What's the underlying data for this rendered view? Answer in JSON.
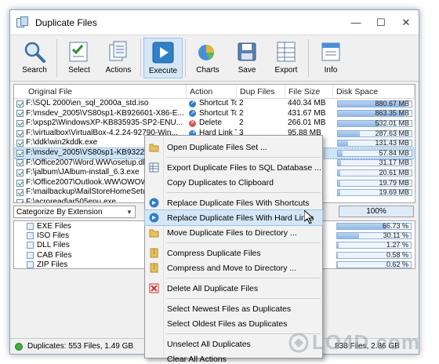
{
  "window": {
    "title": "Duplicate Files",
    "controls": [
      "—",
      "☐",
      "✕"
    ]
  },
  "toolbar": {
    "buttons": [
      {
        "label": "Search",
        "icon": "search-icon"
      },
      {
        "label": "Select",
        "icon": "select-icon"
      },
      {
        "label": "Actions",
        "icon": "actions-icon"
      },
      {
        "label": "Execute",
        "icon": "execute-icon"
      },
      {
        "label": "Charts",
        "icon": "charts-icon"
      },
      {
        "label": "Save",
        "icon": "save-icon"
      },
      {
        "label": "Export",
        "icon": "export-icon"
      },
      {
        "label": "Info",
        "icon": "info-icon"
      }
    ]
  },
  "grid": {
    "columns": [
      "Original File",
      "Action",
      "Dup Files",
      "File Size",
      "Disk Space"
    ],
    "rows": [
      {
        "file": "F:\\SQL 2000\\en_sql_2000a_std.iso",
        "action": "Shortcut To: ...",
        "dup": "2",
        "size": "440.34 MB",
        "disk": "880.67 MB",
        "pct": 92,
        "icon": "shortcut"
      },
      {
        "file": "F:\\msdev_2005\\VS80sp1-KB926601-X86-E...",
        "action": "Shortcut To: ...",
        "dup": "2",
        "size": "431.67 MB",
        "disk": "863.35 MB",
        "pct": 90,
        "icon": "shortcut"
      },
      {
        "file": "F:\\xpsp2\\WindowsXP-KB835935-SP2-ENU...",
        "action": "Delete",
        "dup": "2",
        "size": "266.01 MB",
        "disk": "532.01 MB",
        "pct": 56,
        "icon": "delete"
      },
      {
        "file": "F:\\virtualbox\\VirtualBox-4.2.24-92790-Win...",
        "action": "Hard Link To: ...",
        "dup": "3",
        "size": "95.88 MB",
        "disk": "287.63 MB",
        "pct": 30,
        "icon": "hardlink"
      },
      {
        "file": "F:\\ddk\\win2kddk.exe",
        "action": "Compress",
        "dup": "2",
        "size": "65.71 MB",
        "disk": "131.43 MB",
        "pct": 14,
        "icon": "compress"
      },
      {
        "file": "F:\\msdev_2005\\VS80sp1-KB932232-X",
        "action": "",
        "dup": "",
        "size": "",
        "disk": "57.84 MB",
        "pct": 6,
        "icon": ""
      },
      {
        "file": "F:\\Office2007\\Word.WW\\osetup.dll",
        "action": "",
        "dup": "",
        "size": "",
        "disk": "31.17 MB",
        "pct": 4,
        "icon": ""
      },
      {
        "file": "F:\\jalbum\\JAlbum-install_6.3.exe",
        "action": "",
        "dup": "",
        "size": "",
        "disk": "20.61 MB",
        "pct": 3,
        "icon": ""
      },
      {
        "file": "F:\\Office2007\\Outlook.WW\\OWOWE",
        "action": "",
        "dup": "",
        "size": "",
        "disk": "19.79 MB",
        "pct": 3,
        "icon": ""
      },
      {
        "file": "F:\\mailbackup\\MailStoreHomeSetup",
        "action": "",
        "dup": "",
        "size": "",
        "disk": "19.69 MB",
        "pct": 3,
        "icon": ""
      },
      {
        "file": "F:\\acroread\\ar505enu.exe",
        "action": "",
        "dup": "",
        "size": "",
        "disk": "",
        "pct": 0,
        "icon": ""
      }
    ]
  },
  "categorize": {
    "selected": "Categorize By Extension",
    "percent": "100%"
  },
  "categories": [
    {
      "label": "EXE Files",
      "value": "66.73 %",
      "pct": 67
    },
    {
      "label": "ISO Files",
      "value": "30.11 %",
      "pct": 30
    },
    {
      "label": "DLL Files",
      "value": "1.27 %",
      "pct": 2
    },
    {
      "label": "CAB Files",
      "value": "0.58 %",
      "pct": 1
    },
    {
      "label": "ZIP Files",
      "value": "0.62 %",
      "pct": 1
    }
  ],
  "status": {
    "left": "Duplicates: 553 Files, 1.49 GB",
    "right": "838 Files, 2.86 GB"
  },
  "context_menu": {
    "groups": [
      [
        {
          "label": "Open Duplicate Files Set ...",
          "icon": "folder-icon"
        }
      ],
      [
        {
          "label": "Export Duplicate Files to SQL Database ...",
          "icon": "database-icon"
        },
        {
          "label": "Copy Duplicates to Clipboard",
          "icon": ""
        }
      ],
      [
        {
          "label": "Replace Duplicate Files With Shortcuts",
          "icon": "shortcut-icon"
        },
        {
          "label": "Replace Duplicate Files With Hard Links",
          "icon": "hardlink-icon",
          "highlight": true
        },
        {
          "label": "Move Duplicate Files to Directory ...",
          "icon": "move-icon"
        }
      ],
      [
        {
          "label": "Compress Duplicate Files",
          "icon": "compress-icon"
        },
        {
          "label": "Compress and Move to Directory ...",
          "icon": "compress-move-icon"
        }
      ],
      [
        {
          "label": "Delete All Duplicate Files",
          "icon": "delete-icon"
        }
      ],
      [
        {
          "label": "Select Newest Files as Duplicates",
          "icon": ""
        },
        {
          "label": "Select Oldest Files as Duplicates",
          "icon": ""
        }
      ],
      [
        {
          "label": "Unselect All Duplicates",
          "icon": ""
        },
        {
          "label": "Clear All Actions",
          "icon": ""
        }
      ]
    ]
  },
  "watermark": "LO4D.com",
  "colors": {
    "accent": "#3c7fc5",
    "selection": "#cde4f8",
    "bar": "#92b9e6"
  }
}
